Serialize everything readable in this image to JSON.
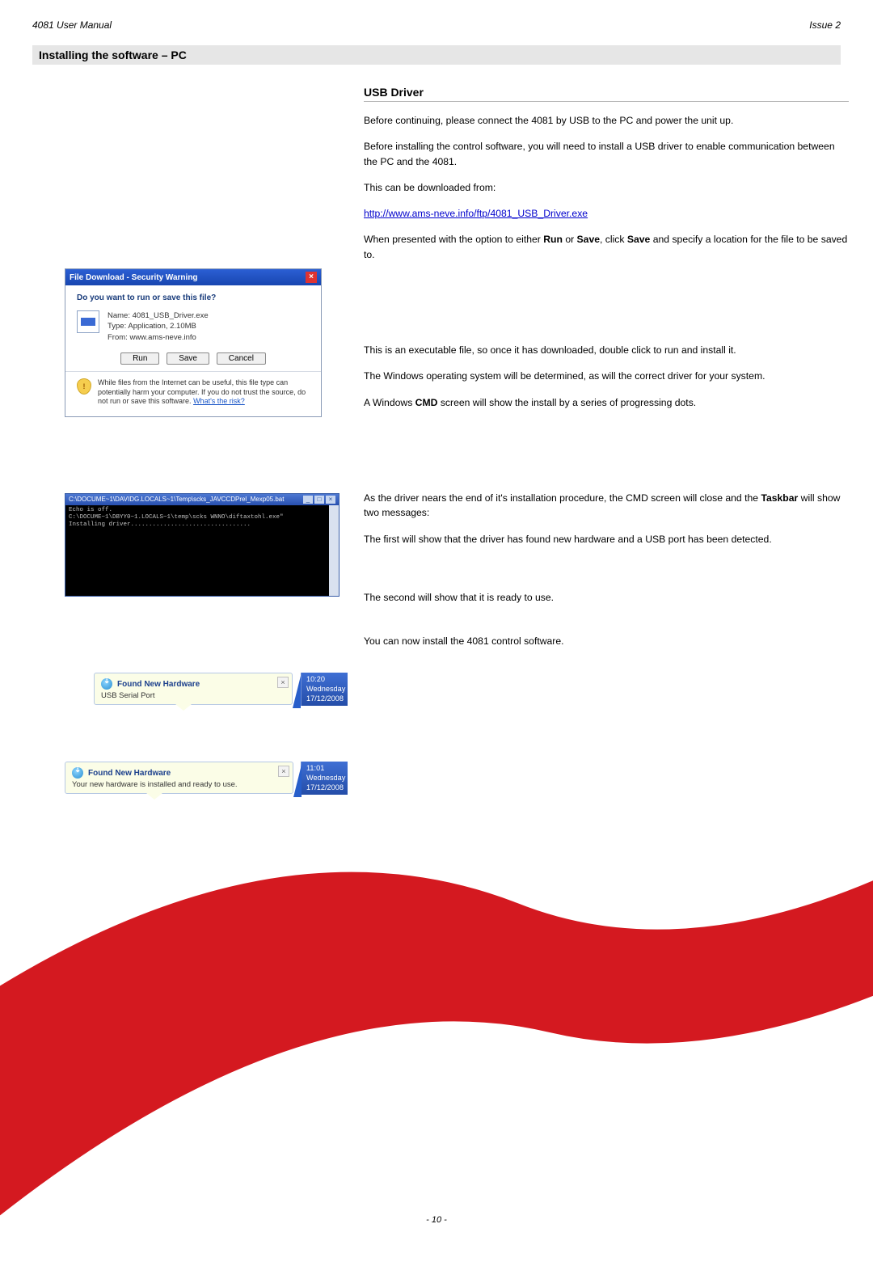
{
  "header": {
    "left": "4081 User Manual",
    "right": "Issue 2"
  },
  "section_title": "Installing the software – PC",
  "subheading": "USB Driver",
  "p1": "Before continuing, please connect the 4081 by USB to the PC and power the unit up.",
  "p2": "Before installing the control software, you will need to install a USB driver to enable communication between the PC and the 4081.",
  "p3": "This can be downloaded from:",
  "link": "http://www.ams-neve.info/ftp/4081_USB_Driver.exe",
  "p4a": "When presented with the option to either ",
  "p4b": " or ",
  "p4c": ", click ",
  "p4d": " and specify a location for the file to be saved to.",
  "bold_run": "Run",
  "bold_save": "Save",
  "bold_save2": "Save",
  "p5": "This is an executable file, so once it has downloaded, double click to run and install it.",
  "p6": "The Windows operating system will be determined, as will the correct driver for your system.",
  "p7a": "A Windows ",
  "p7b": " screen will show the install by a series of progressing dots.",
  "bold_cmd": "CMD",
  "p8a": "As the driver nears the end of it's installation procedure, the CMD screen will close and the ",
  "p8b": " will show two messages:",
  "bold_taskbar": "Taskbar",
  "p9": "The first will show that the driver has found new hardware and a USB port has been detected.",
  "p10": "The second will show that it is ready to use.",
  "p11": "You can now install the 4081 control software.",
  "page_number": "- 10 -",
  "dialog": {
    "title": "File Download - Security Warning",
    "question": "Do you want to run or save this file?",
    "name_lbl": "Name:",
    "name_val": "4081_USB_Driver.exe",
    "type_lbl": "Type:",
    "type_val": "Application, 2.10MB",
    "from_lbl": "From:",
    "from_val": "www.ams-neve.info",
    "btn_run": "Run",
    "btn_save": "Save",
    "btn_cancel": "Cancel",
    "warn": "While files from the Internet can be useful, this file type can potentially harm your computer. If you do not trust the source, do not run or save this software. ",
    "risk": "What's the risk?"
  },
  "cmd": {
    "title": "C:\\DOCUME~1\\DAVIDG.LOCALS~1\\Temp\\scks_JAVCCDPrel_Mexp05.bat",
    "line1": "Echo is off.",
    "line2": "C:\\DOCUME~1\\DBYY0~1.LOCALS~1\\temp\\scks WNNO\\diftaxtohl.exe\"",
    "line3": "Installing driver................................."
  },
  "toast1": {
    "title": "Found New Hardware",
    "sub": "USB Serial Port"
  },
  "toast2": {
    "title": "Found New Hardware",
    "sub": "Your new hardware is installed and ready to use."
  },
  "clock1": {
    "time": "10:20",
    "day": "Wednesday",
    "date": "17/12/2008"
  },
  "clock2": {
    "time": "11:01",
    "day": "Wednesday",
    "date": "17/12/2008"
  }
}
